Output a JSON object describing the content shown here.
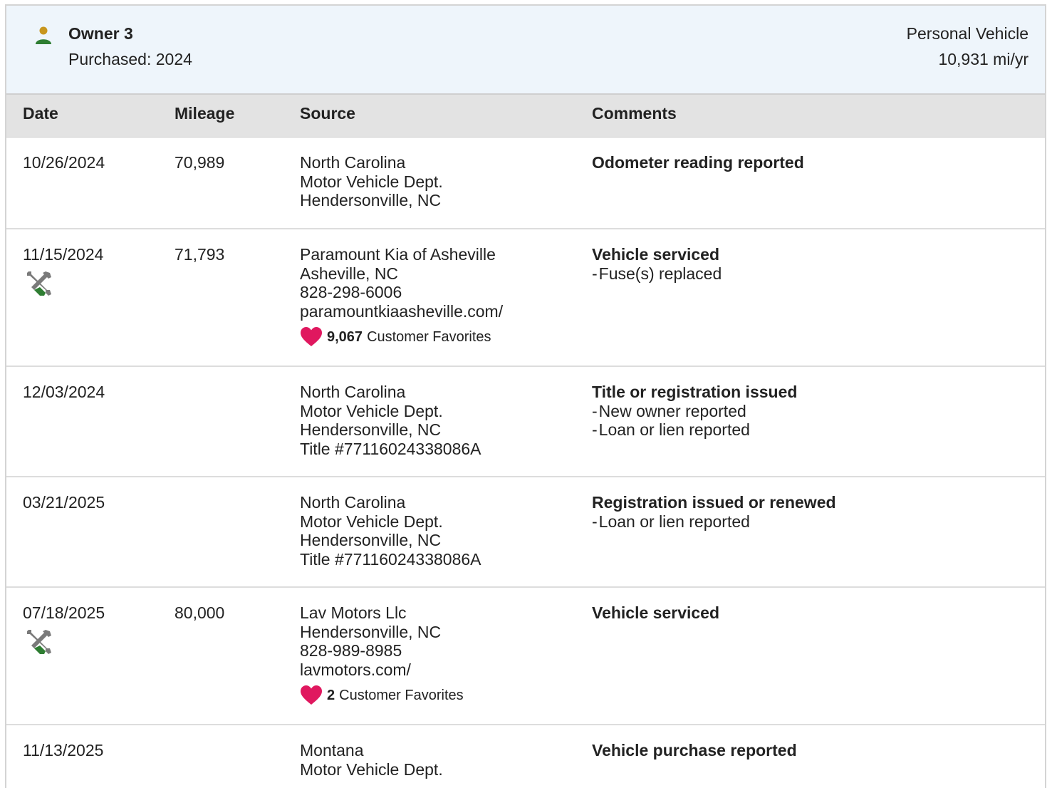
{
  "owner": {
    "name": "Owner 3",
    "purchased": "Purchased: 2024",
    "vehicle_type": "Personal Vehicle",
    "annual_miles": "10,931 mi/yr",
    "icon": "person-icon"
  },
  "table": {
    "headers": [
      "Date",
      "Mileage",
      "Source",
      "Comments"
    ],
    "rows": [
      {
        "date": "10/26/2024",
        "mileage": "70,989",
        "source": [
          "North Carolina",
          "Motor Vehicle Dept.",
          "Hendersonville, NC"
        ],
        "comment_title": "Odometer reading reported",
        "comment_details": []
      },
      {
        "date": "11/15/2024",
        "mileage": "71,793",
        "service_icon": "wrench-screwdriver-icon",
        "source": [
          "Paramount Kia of Asheville",
          "Asheville, NC",
          "828-298-6006",
          "paramountkiaasheville.com/"
        ],
        "favorites_count": "9,067",
        "favorites_label": "Customer Favorites",
        "comment_title": "Vehicle serviced",
        "comment_details": [
          "Fuse(s) replaced"
        ]
      },
      {
        "date": "12/03/2024",
        "mileage": "",
        "source": [
          "North Carolina",
          "Motor Vehicle Dept.",
          "Hendersonville, NC",
          "Title #77116024338086A"
        ],
        "comment_title": "Title or registration issued",
        "comment_details": [
          "New owner reported",
          "Loan or lien reported"
        ]
      },
      {
        "date": "03/21/2025",
        "mileage": "",
        "source": [
          "North Carolina",
          "Motor Vehicle Dept.",
          "Hendersonville, NC",
          "Title #77116024338086A"
        ],
        "comment_title": "Registration issued or renewed",
        "comment_details": [
          "Loan or lien reported"
        ]
      },
      {
        "date": "07/18/2025",
        "mileage": "80,000",
        "service_icon": "wrench-screwdriver-icon",
        "source": [
          "Lav Motors Llc",
          "Hendersonville, NC",
          "828-989-8985",
          "lavmotors.com/"
        ],
        "favorites_count": "2",
        "favorites_label": "Customer Favorites",
        "comment_title": "Vehicle serviced",
        "comment_details": []
      },
      {
        "date": "11/13/2025",
        "mileage": "",
        "source": [
          "Montana",
          "Motor Vehicle Dept."
        ],
        "comment_title": "Vehicle purchase reported",
        "comment_details": []
      }
    ]
  },
  "colors": {
    "person_head": "#c8961e",
    "person_body": "#2e7d32",
    "heart": "#e0185f",
    "wrench": "#7a7a7a",
    "screwdriver_handle": "#2e7d32"
  }
}
